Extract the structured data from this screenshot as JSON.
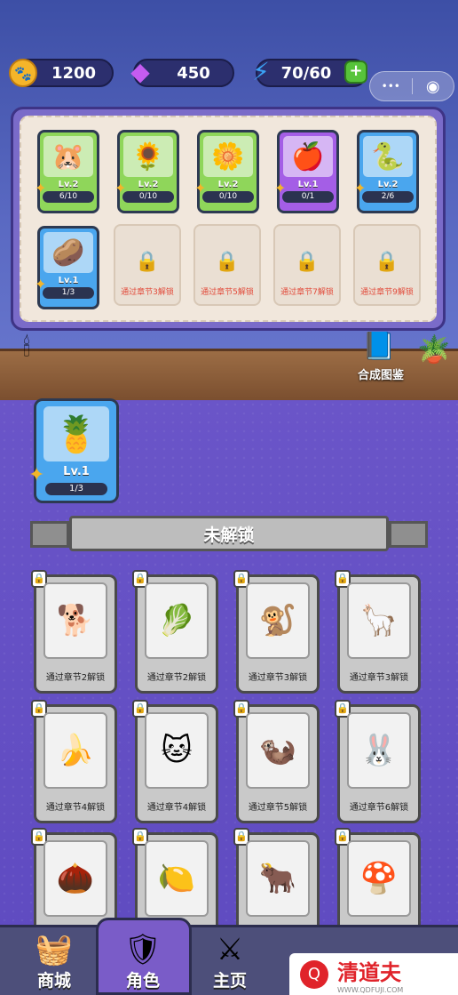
{
  "resources": {
    "coins": "1200",
    "gems": "450",
    "energy": "70/60",
    "add_label": "+"
  },
  "mini_program": {
    "more": "•••",
    "close": "◉"
  },
  "collection": {
    "cards": [
      {
        "level": "Lv.2",
        "progress": "6/10",
        "icon": "hamster-icon",
        "glyph": "🐹",
        "color": "green"
      },
      {
        "level": "Lv.2",
        "progress": "0/10",
        "icon": "sunflower-icon",
        "glyph": "🌻",
        "color": "green"
      },
      {
        "level": "Lv.2",
        "progress": "0/10",
        "icon": "daisy-icon",
        "glyph": "🌼",
        "color": "green"
      },
      {
        "level": "Lv.1",
        "progress": "0/1",
        "icon": "apple-icon",
        "glyph": "🍎",
        "color": "purple"
      },
      {
        "level": "Lv.2",
        "progress": "2/6",
        "icon": "snake-icon",
        "glyph": "🐍",
        "color": "blue"
      },
      {
        "level": "Lv.1",
        "progress": "1/3",
        "icon": "potato-icon",
        "glyph": "🥔",
        "color": "blue"
      }
    ],
    "locked": [
      {
        "text": "通过章节3解锁"
      },
      {
        "text": "通过章节5解锁"
      },
      {
        "text": "通过章节7解锁"
      },
      {
        "text": "通过章节9解锁"
      }
    ],
    "book_label": "合成图鉴"
  },
  "featured": {
    "level": "Lv.1",
    "progress": "1/3",
    "glyph": "🍍"
  },
  "section_title": "未解锁",
  "locked_characters": [
    {
      "text": "通过章节2解锁",
      "glyph": "🐕",
      "icon": "doberman-icon"
    },
    {
      "text": "通过章节2解锁",
      "glyph": "🥬",
      "icon": "radish-icon"
    },
    {
      "text": "通过章节3解锁",
      "glyph": "🐒",
      "icon": "monkey-icon"
    },
    {
      "text": "通过章节3解锁",
      "glyph": "🦙",
      "icon": "alpaca-icon"
    },
    {
      "text": "通过章节4解锁",
      "glyph": "🍌",
      "icon": "banana-icon"
    },
    {
      "text": "通过章节4解锁",
      "glyph": "🐱",
      "icon": "cat-icon"
    },
    {
      "text": "通过章节5解锁",
      "glyph": "🦦",
      "icon": "otter-icon"
    },
    {
      "text": "通过章节6解锁",
      "glyph": "🐰",
      "icon": "rabbit-icon"
    },
    {
      "text": "",
      "glyph": "🌰",
      "icon": "durian-icon"
    },
    {
      "text": "",
      "glyph": "🍋",
      "icon": "lemon-icon"
    },
    {
      "text": "",
      "glyph": "🐂",
      "icon": "bull-icon"
    },
    {
      "text": "",
      "glyph": "🍄",
      "icon": "mushroom-icon"
    }
  ],
  "nav": [
    {
      "label": "商城",
      "glyph": "🧺",
      "icon": "shop-icon"
    },
    {
      "label": "角色",
      "glyph": "🛡",
      "icon": "character-shield-icon"
    },
    {
      "label": "主页",
      "glyph": "⚔",
      "icon": "swords-icon"
    }
  ],
  "watermark": {
    "text": "清道夫",
    "url": "WWW.QDFUJI.COM"
  }
}
